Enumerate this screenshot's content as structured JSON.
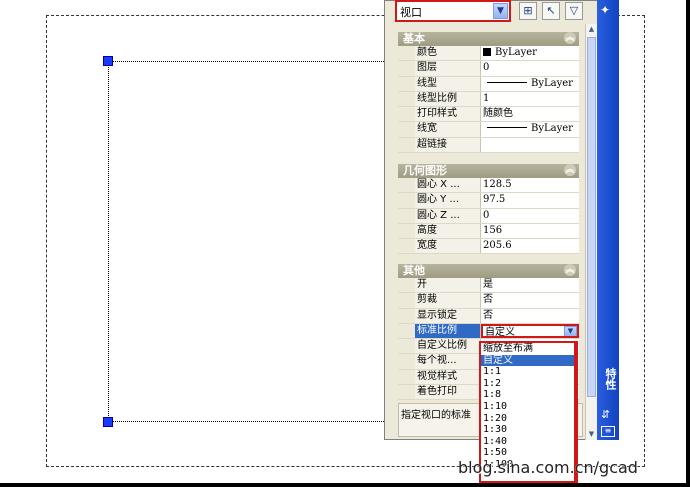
{
  "object_selector": {
    "value": "视口"
  },
  "toolbar": {
    "quick_select_icon": "quick-select-icon",
    "select_objects_icon": "select-objects-icon",
    "pickadd_icon": "pickadd-toggle-icon"
  },
  "palette_title": "特性",
  "sections": {
    "basic": {
      "title": "基本",
      "rows": [
        {
          "name": "颜色",
          "value": "ByLayer",
          "kind": "color"
        },
        {
          "name": "图层",
          "value": "0"
        },
        {
          "name": "线型",
          "value": "ByLayer",
          "kind": "linetype"
        },
        {
          "name": "线型比例",
          "value": "1"
        },
        {
          "name": "打印样式",
          "value": "随颜色"
        },
        {
          "name": "线宽",
          "value": "ByLayer",
          "kind": "linetype"
        },
        {
          "name": "超链接",
          "value": ""
        }
      ]
    },
    "geometry": {
      "title": "几何图形",
      "rows": [
        {
          "name": "圆心 X ...",
          "value": "128.5"
        },
        {
          "name": "圆心 Y ...",
          "value": "97.5"
        },
        {
          "name": "圆心 Z ...",
          "value": "0"
        },
        {
          "name": "高度",
          "value": "156"
        },
        {
          "name": "宽度",
          "value": "205.6"
        }
      ]
    },
    "misc": {
      "title": "其他",
      "rows": [
        {
          "name": "开",
          "value": "是"
        },
        {
          "name": "剪裁",
          "value": "否"
        },
        {
          "name": "显示锁定",
          "value": "否"
        },
        {
          "name": "标准比例",
          "value": "自定义",
          "selected": true
        },
        {
          "name": "自定义比例",
          "value": ""
        },
        {
          "name": "每个视...",
          "value": ""
        },
        {
          "name": "视觉样式",
          "value": ""
        },
        {
          "name": "着色打印",
          "value": ""
        }
      ]
    }
  },
  "description": "指定视口的标准",
  "scale_dropdown": {
    "items": [
      "缩放至布满",
      "自定义",
      "1:1",
      "1:2",
      "1:8",
      "1:10",
      "1:20",
      "1:30",
      "1:40",
      "1:50",
      "1:100"
    ],
    "highlighted": "自定义"
  },
  "watermark": "blog.sina.com.cn/gcad"
}
